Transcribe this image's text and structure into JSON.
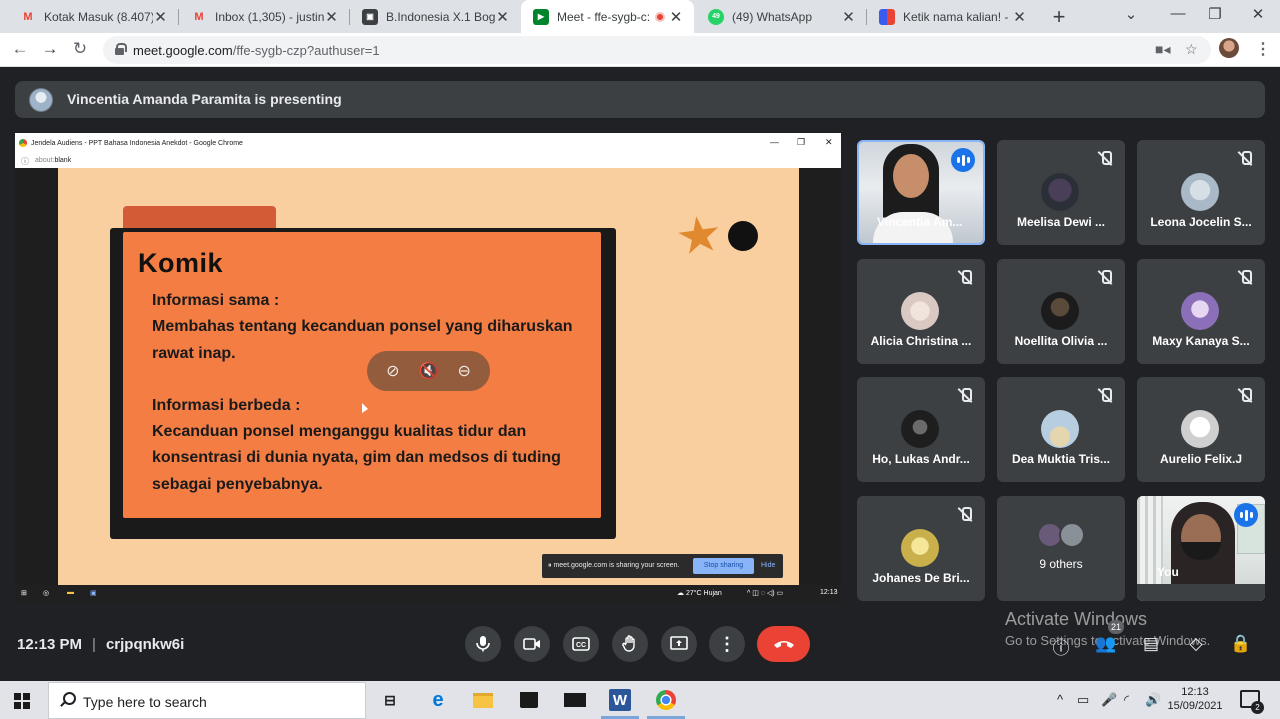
{
  "browser": {
    "tabs": [
      {
        "label": "Kotak Masuk (8.407) - ",
        "icon": "gmail-icon",
        "color": "#ea4335"
      },
      {
        "label": "Inbox (1,305) - justina",
        "icon": "gmail-icon",
        "color": "#ea4335"
      },
      {
        "label": "B.Indonesia X.1 Boga P",
        "icon": "classroom-icon",
        "color": "#1e8e3e"
      },
      {
        "label": "Meet - ffe-sygb-c:",
        "icon": "meet-icon",
        "color": "#00832d"
      },
      {
        "label": "(49) WhatsApp",
        "icon": "whatsapp-icon",
        "color": "#25d366",
        "badge": "49"
      },
      {
        "label": "Ketik nama kalian! - M",
        "icon": "mentimeter-icon",
        "color": "#3a5bf0"
      }
    ],
    "url_host": "meet.google.com",
    "url_path": "/ffe-sygb-czp?authuser=1"
  },
  "meeting": {
    "presenter_banner": "Vincentia Amanda Paramita is presenting",
    "time": "12:13 PM",
    "code": "crjpqnkw6i",
    "people_count": "21",
    "activate_title": "Activate Windows",
    "activate_sub": "Go to Settings to activate Windows."
  },
  "shared_screen": {
    "window_title": "Jendela Audiens - PPT Bahasa Indonesia Anekdot - Google Chrome",
    "url_prefix": "about:",
    "url_rest": "blank",
    "slide": {
      "title": "Komik",
      "lines_same": [
        "Informasi sama :",
        "Membahas tentang kecanduan ponsel yang diharuskan",
        "rawat inap."
      ],
      "lines_diff": [
        "Informasi berbeda :",
        "Kecanduan ponsel menganggu kualitas tidur dan",
        "konsentrasi di dunia nyata, gim dan medsos di tuding",
        "sebagai penyebabnya."
      ]
    },
    "share_notice": "meet.google.com is sharing your screen.",
    "stop_sharing": "Stop sharing",
    "hide": "Hide",
    "tray_weather": "27°C  Hujan",
    "tray_time": "12:13"
  },
  "participants": [
    {
      "name": "Vincentia Am...",
      "speaking": true,
      "video": true
    },
    {
      "name": "Meelisa Dewi ...",
      "muted": true,
      "avatar_color": "#2b2f38"
    },
    {
      "name": "Leona Jocelin S...",
      "muted": true,
      "avatar_color": "#a9b9c7"
    },
    {
      "name": "Alicia Christina ...",
      "muted": true,
      "avatar_color": "#d9c9c2"
    },
    {
      "name": "Noellita Olivia ...",
      "muted": true,
      "avatar_color": "#1c1c1c"
    },
    {
      "name": "Maxy Kanaya S...",
      "muted": true,
      "avatar_color": "#8b6fb8"
    },
    {
      "name": "Ho, Lukas Andr...",
      "muted": true,
      "avatar_color": "#1e1e1e"
    },
    {
      "name": "Dea Muktia Tris...",
      "muted": true,
      "avatar_color": "#b7cde0"
    },
    {
      "name": "Aurelio Felix.J",
      "muted": true,
      "avatar_color": "#e8e8e8"
    },
    {
      "name": "Johanes De Bri...",
      "muted": true,
      "avatar_color": "#c9b04a"
    },
    {
      "name": "9 others"
    },
    {
      "name": "You",
      "speaking": true,
      "video": true
    }
  ],
  "taskbar": {
    "search_placeholder": "Type here to search",
    "time": "12:13",
    "date": "15/09/2021",
    "notifications": "2"
  }
}
